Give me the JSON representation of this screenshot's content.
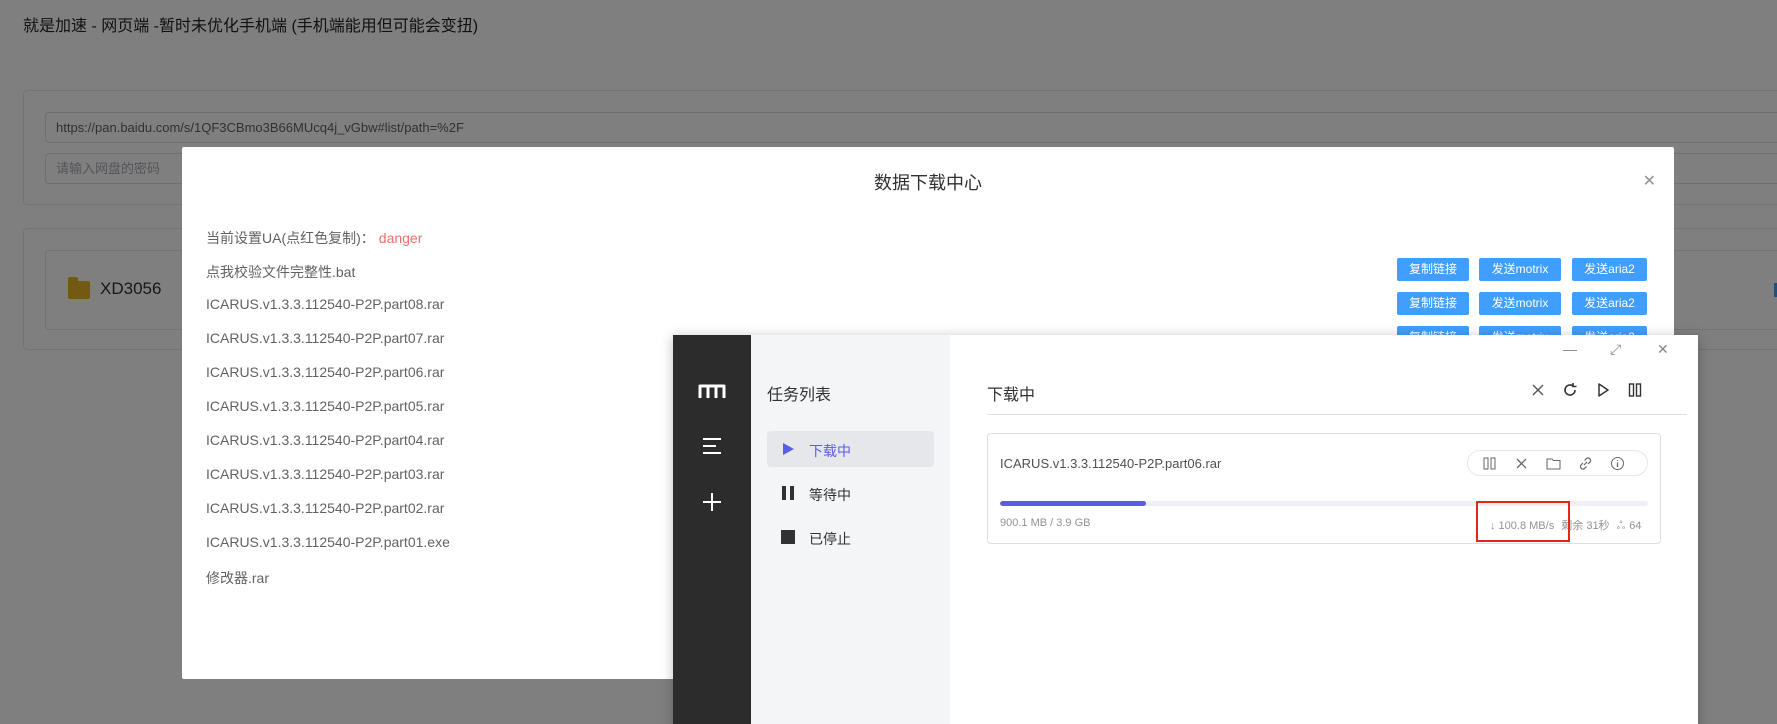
{
  "page": {
    "title": "就是加速 - 网页端 -暂时未优化手机端 (手机端能用但可能会变扭)",
    "url_value": "https://pan.baidu.com/s/1QF3CBmo3B66MUcq4j_vGbw#list/path=%2F",
    "password_placeholder": "请输入网盘的密码",
    "folder_name": "XD3056"
  },
  "dialog": {
    "title": "数据下载中心",
    "ua_label": "当前设置UA(点红色复制)：",
    "ua_value": "danger",
    "buttons": {
      "copy": "复制链接",
      "motrix": "发送motrix",
      "aria2": "发送aria2"
    },
    "files": [
      "点我校验文件完整性.bat",
      "ICARUS.v1.3.3.112540-P2P.part08.rar",
      "ICARUS.v1.3.3.112540-P2P.part07.rar",
      "ICARUS.v1.3.3.112540-P2P.part06.rar",
      "ICARUS.v1.3.3.112540-P2P.part05.rar",
      "ICARUS.v1.3.3.112540-P2P.part04.rar",
      "ICARUS.v1.3.3.112540-P2P.part03.rar",
      "ICARUS.v1.3.3.112540-P2P.part02.rar",
      "ICARUS.v1.3.3.112540-P2P.part01.exe",
      "修改器.rar"
    ]
  },
  "motrix": {
    "panel_title": "任务列表",
    "nav": [
      {
        "label": "下载中",
        "icon": "play-icon"
      },
      {
        "label": "等待中",
        "icon": "pause-icon"
      },
      {
        "label": "已停止",
        "icon": "stop-icon"
      }
    ],
    "main_title": "下载中",
    "task": {
      "name": "ICARUS.v1.3.3.112540-P2P.part06.rar",
      "size": "900.1 MB / 3.9 GB",
      "progress": 0.225,
      "speed": "↓ 100.8 MB/s",
      "remaining": "剩余 31秒",
      "connections": "64"
    },
    "accent_color": "#5b5bea"
  },
  "colors": {
    "primary_button": "#409eff",
    "danger": "#f56c6c",
    "highlight": "#e8251b"
  }
}
